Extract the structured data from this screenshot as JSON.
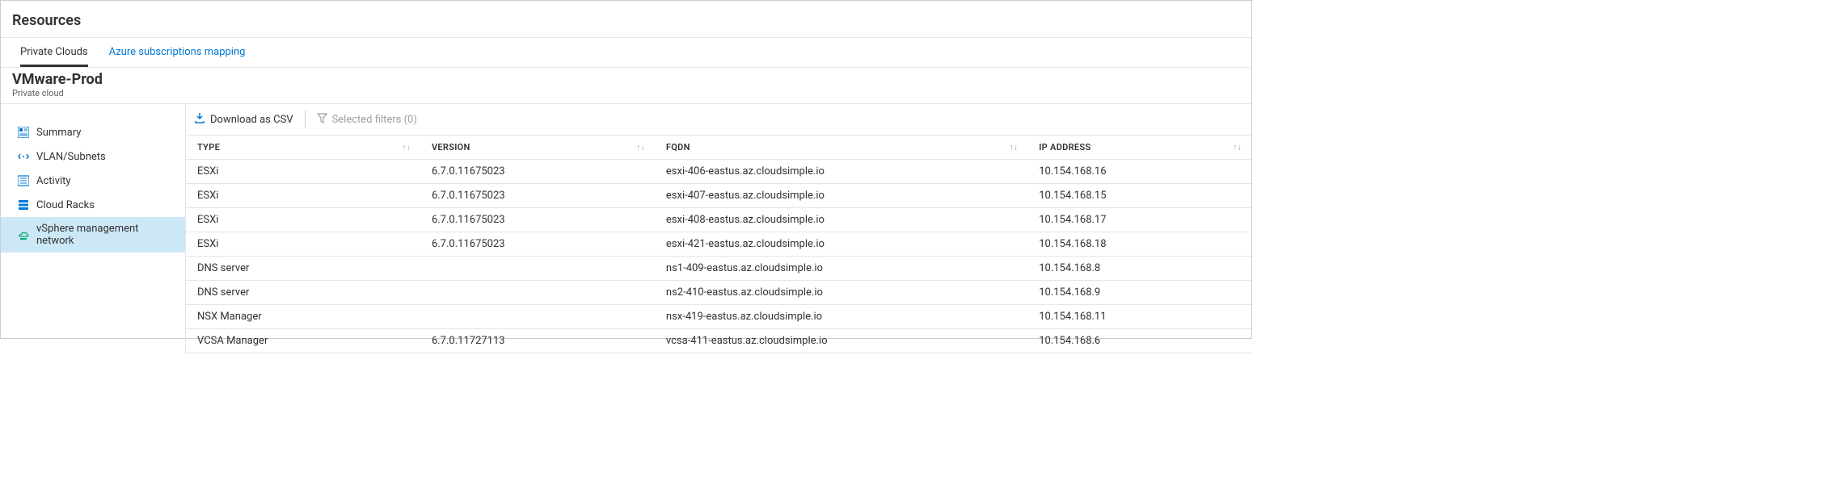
{
  "header": {
    "title": "Resources"
  },
  "tabs": [
    {
      "label": "Private Clouds",
      "active": true
    },
    {
      "label": "Azure subscriptions mapping",
      "active": false
    }
  ],
  "titleBlock": {
    "name": "VMware-Prod",
    "subtitle": "Private cloud"
  },
  "sidebar": [
    {
      "id": "summary",
      "label": "Summary",
      "icon": "summary-icon",
      "active": false
    },
    {
      "id": "vlan",
      "label": "VLAN/Subnets",
      "icon": "vlan-icon",
      "active": false
    },
    {
      "id": "activity",
      "label": "Activity",
      "icon": "activity-icon",
      "active": false
    },
    {
      "id": "cloudracks",
      "label": "Cloud Racks",
      "icon": "racks-icon",
      "active": false
    },
    {
      "id": "vsphere",
      "label": "vSphere management network",
      "icon": "vsphere-icon",
      "active": true
    }
  ],
  "toolbar": {
    "download": "Download as CSV",
    "filters": "Selected filters (0)"
  },
  "table": {
    "columns": [
      "TYPE",
      "VERSION",
      "FQDN",
      "IP ADDRESS"
    ],
    "rows": [
      {
        "type": "ESXi",
        "version": "6.7.0.11675023",
        "fqdn": "esxi-406-eastus.az.cloudsimple.io",
        "ip": "10.154.168.16"
      },
      {
        "type": "ESXi",
        "version": "6.7.0.11675023",
        "fqdn": "esxi-407-eastus.az.cloudsimple.io",
        "ip": "10.154.168.15"
      },
      {
        "type": "ESXi",
        "version": "6.7.0.11675023",
        "fqdn": "esxi-408-eastus.az.cloudsimple.io",
        "ip": "10.154.168.17"
      },
      {
        "type": "ESXi",
        "version": "6.7.0.11675023",
        "fqdn": "esxi-421-eastus.az.cloudsimple.io",
        "ip": "10.154.168.18"
      },
      {
        "type": "DNS server",
        "version": "",
        "fqdn": "ns1-409-eastus.az.cloudsimple.io",
        "ip": "10.154.168.8"
      },
      {
        "type": "DNS server",
        "version": "",
        "fqdn": "ns2-410-eastus.az.cloudsimple.io",
        "ip": "10.154.168.9"
      },
      {
        "type": "NSX Manager",
        "version": "",
        "fqdn": "nsx-419-eastus.az.cloudsimple.io",
        "ip": "10.154.168.11"
      },
      {
        "type": "VCSA Manager",
        "version": "6.7.0.11727113",
        "fqdn": "vcsa-411-eastus.az.cloudsimple.io",
        "ip": "10.154.168.6"
      }
    ]
  }
}
